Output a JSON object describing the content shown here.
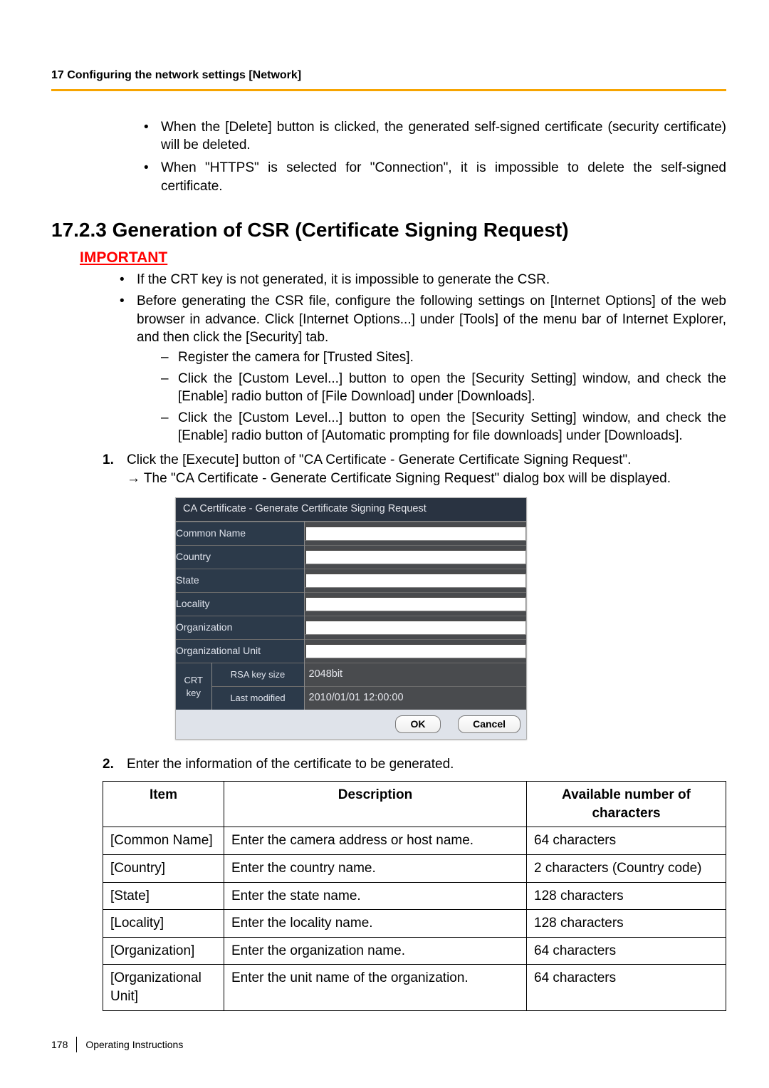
{
  "header": {
    "running": "17 Configuring the network settings [Network]"
  },
  "intro_bullets": [
    "When the [Delete] button is clicked, the generated self-signed certificate (security certificate) will be deleted.",
    "When \"HTTPS\" is selected for \"Connection\", it is impossible to delete the self-signed certificate."
  ],
  "section": {
    "number_title": "17.2.3  Generation of CSR (Certificate Signing Request)",
    "important_label": "IMPORTANT",
    "important_bullets": [
      "If the CRT key is not generated, it is impossible to generate the CSR.",
      "Before generating the CSR file, configure the following settings on [Internet Options] of the web browser in advance. Click [Internet Options...] under [Tools] of the menu bar of Internet Explorer, and then click the [Security] tab."
    ],
    "dash_bullets": [
      "Register the camera for [Trusted Sites].",
      "Click the [Custom Level...] button to open the [Security Setting] window, and check the [Enable] radio button of [File Download] under [Downloads].",
      "Click the [Custom Level...] button to open the [Security Setting] window, and check the [Enable] radio button of [Automatic prompting for file downloads] under [Downloads]."
    ],
    "steps": [
      {
        "text": "Click the [Execute] button of \"CA Certificate - Generate Certificate Signing Request\".",
        "arrow": "→ The \"CA Certificate - Generate Certificate Signing Request\" dialog box will be displayed."
      },
      {
        "text": "Enter the information of the certificate to be generated."
      }
    ]
  },
  "dialog": {
    "title": "CA Certificate - Generate Certificate Signing Request",
    "rows": [
      "Common Name",
      "Country",
      "State",
      "Locality",
      "Organization",
      "Organizational Unit"
    ],
    "crt_label": "CRT key",
    "crt_rows": [
      {
        "sub": "RSA key size",
        "value": "2048bit"
      },
      {
        "sub": "Last modified",
        "value": "2010/01/01 12:00:00"
      }
    ],
    "ok": "OK",
    "cancel": "Cancel"
  },
  "table": {
    "headers": [
      "Item",
      "Description",
      "Available number of characters"
    ],
    "rows": [
      [
        "[Common Name]",
        "Enter the camera address or host name.",
        "64 characters"
      ],
      [
        "[Country]",
        "Enter the country name.",
        "2 characters (Country code)"
      ],
      [
        "[State]",
        "Enter the state name.",
        "128 characters"
      ],
      [
        "[Locality]",
        "Enter the locality name.",
        "128 characters"
      ],
      [
        "[Organization]",
        "Enter the organization name.",
        "64 characters"
      ],
      [
        "[Organizational Unit]",
        "Enter the unit name of the organization.",
        "64 characters"
      ]
    ]
  },
  "footer": {
    "page": "178",
    "doc": "Operating Instructions"
  }
}
